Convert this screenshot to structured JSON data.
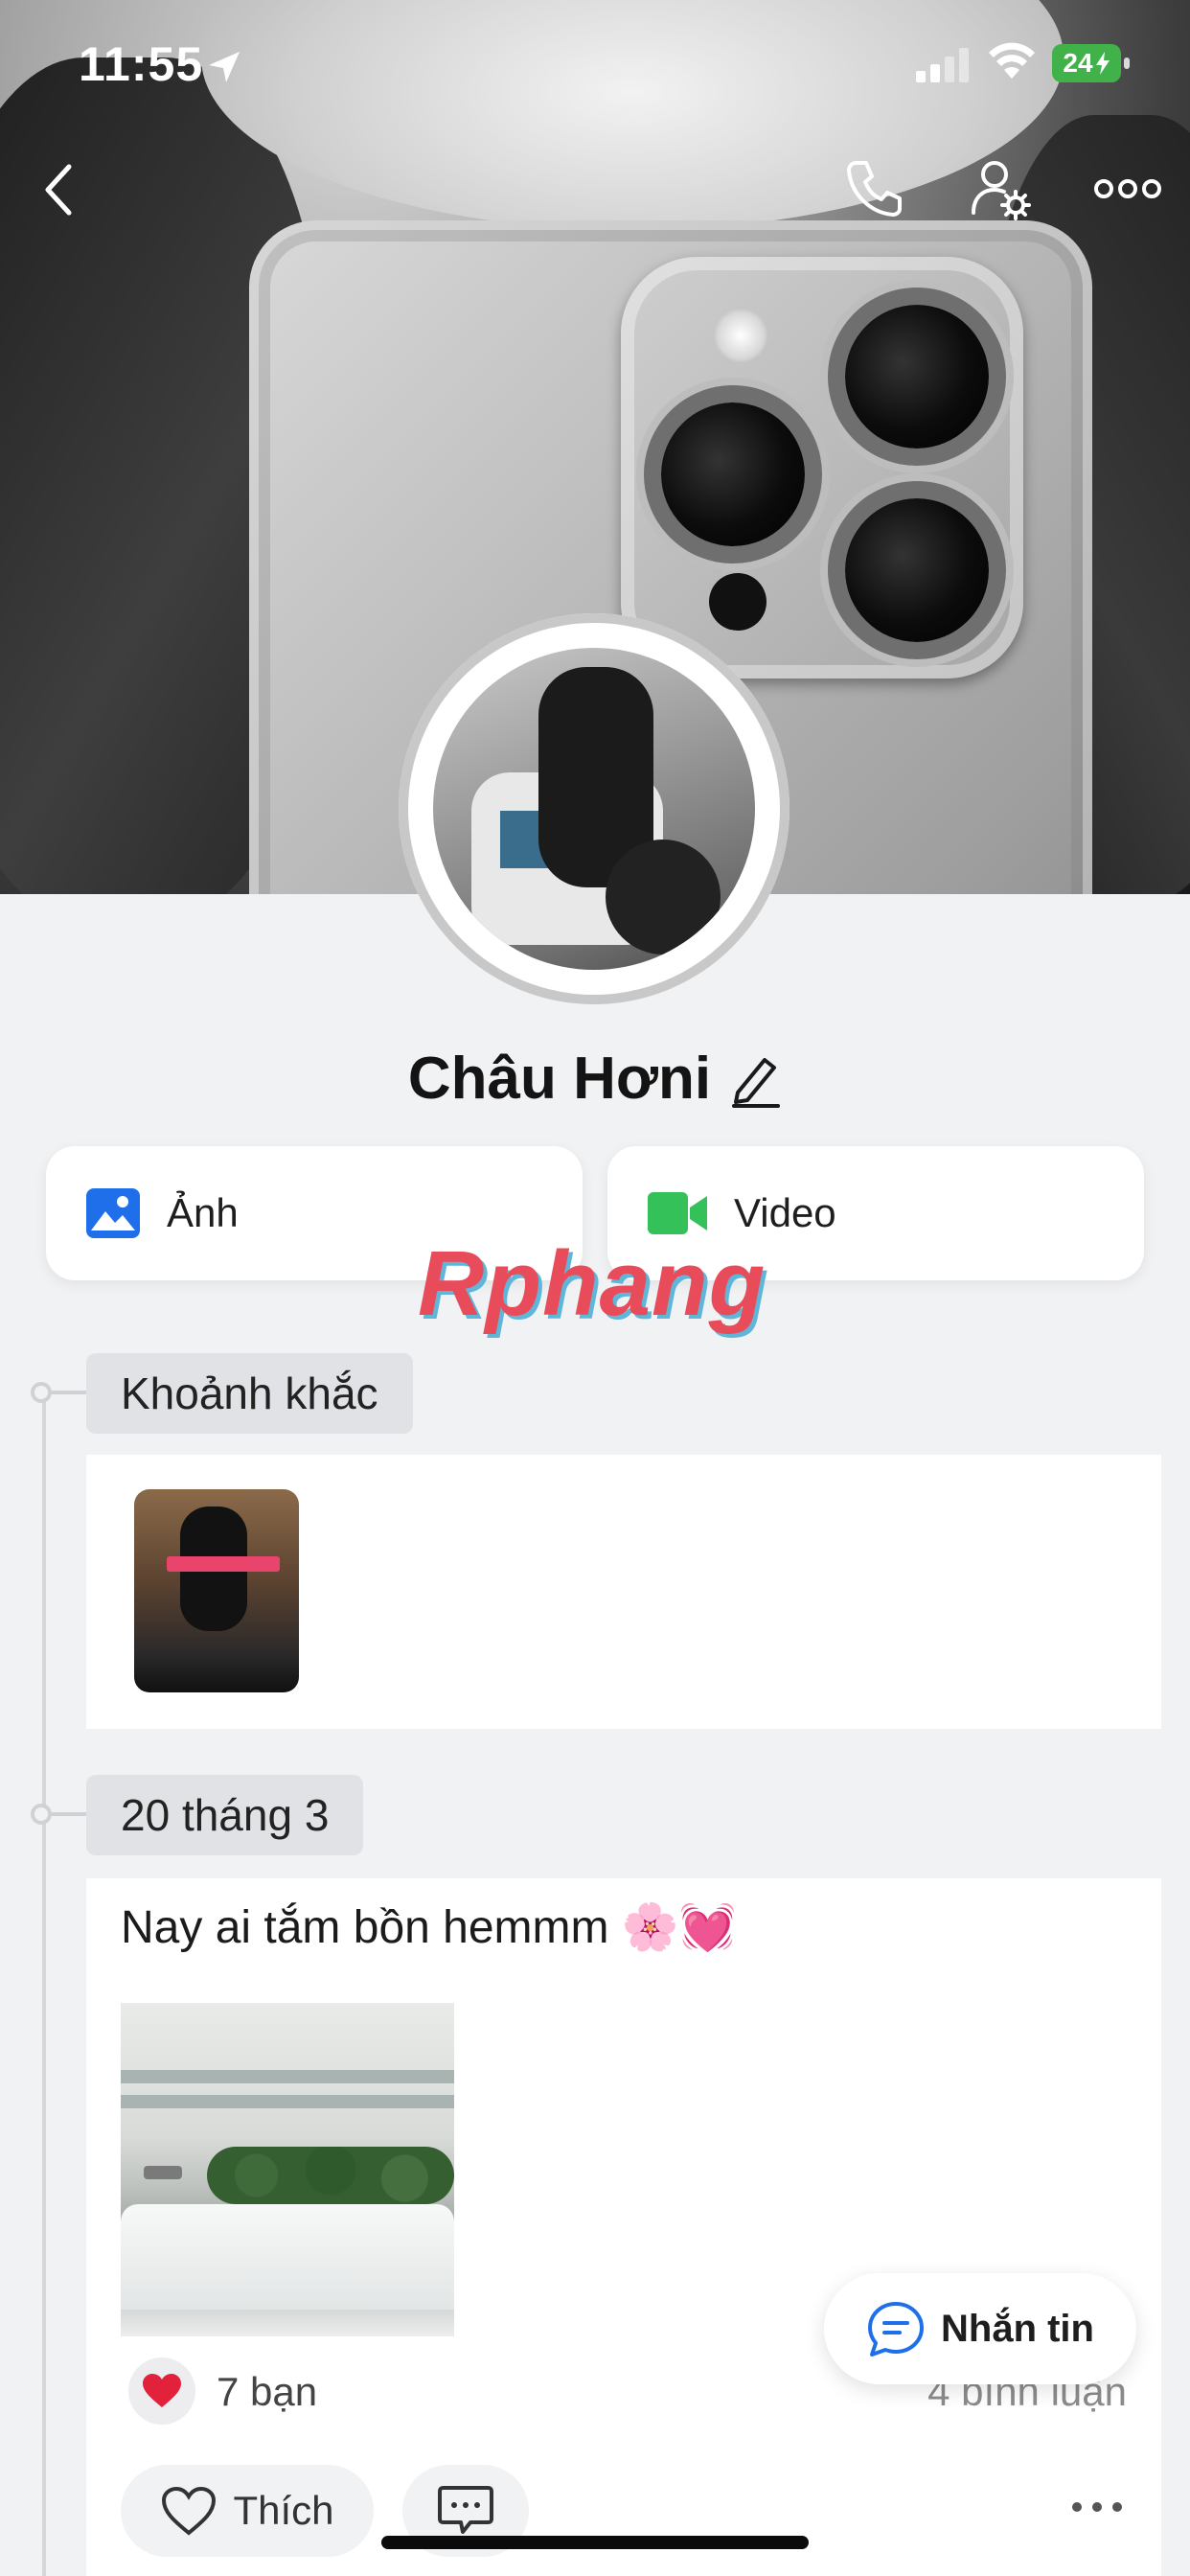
{
  "status_bar": {
    "time": "11:55",
    "battery": "24"
  },
  "profile": {
    "name": "Châu Hơni"
  },
  "media_tabs": [
    {
      "label": "Ảnh",
      "icon": "photo-icon",
      "color": "#1f6feb"
    },
    {
      "label": "Video",
      "icon": "video-camera-icon",
      "color": "#34c15a"
    }
  ],
  "watermark": "Rphang",
  "timeline": {
    "moments_label": "Khoảnh khắc",
    "post_date": "20 tháng 3"
  },
  "post": {
    "text": "Nay ai tắm bồn hemmm 🌸💓",
    "reaction_count": "7 bạn",
    "comment_count": "4 bình luận",
    "like_label": "Thích"
  },
  "message_button": {
    "label": "Nhắn tin"
  },
  "colors": {
    "accent": "#1f6feb",
    "video_green": "#34c15a",
    "like_red": "#e2223b",
    "background": "#f1f2f4"
  }
}
